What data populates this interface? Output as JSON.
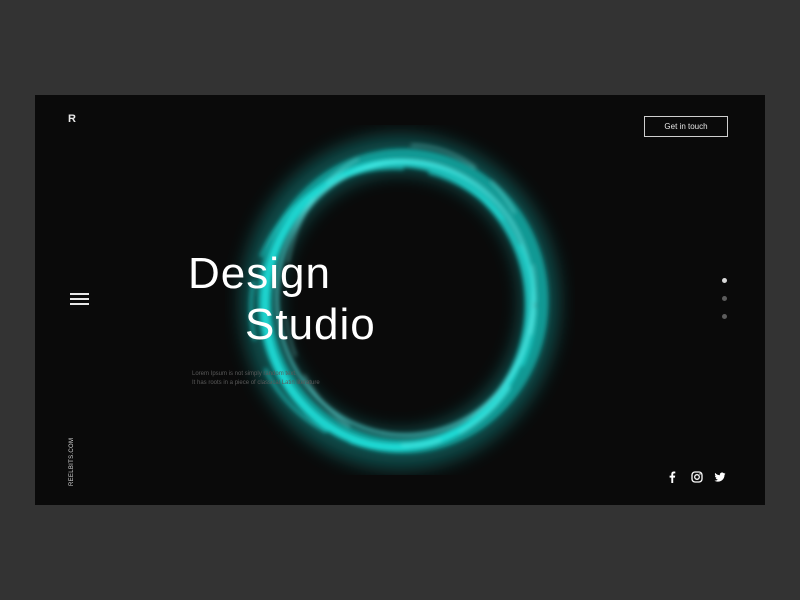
{
  "brand": {
    "logo": "R",
    "site_url": "REELBITS.COM"
  },
  "header": {
    "cta_label": "Get in touch"
  },
  "hero": {
    "title_line1": "Design",
    "title_line2": "Studio",
    "description_line1": "Lorem Ipsum is not simply random text.",
    "description_line2": "It has roots in a piece of classical Latin literature"
  },
  "pagination": {
    "total": 3,
    "active_index": 0
  },
  "social": [
    "facebook-icon",
    "instagram-icon",
    "twitter-icon"
  ],
  "colors": {
    "page_bg": "#333333",
    "panel_bg": "#0a0a0a",
    "accent": "#19e6e0",
    "text": "#ffffff"
  }
}
